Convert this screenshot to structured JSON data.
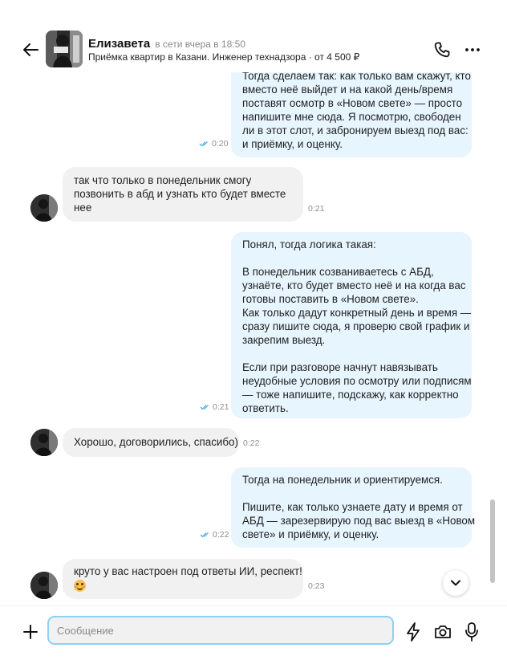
{
  "header": {
    "name": "Елизавета",
    "status": "в сети вчера в 18:50",
    "subtitle": "Приёмка квартир в Казани. Инженер технадзора · от 4 500 ₽"
  },
  "messages": [
    {
      "direction": "outgoing",
      "lines": [
        "Тогда сделаем так: как только вам скажут, кто",
        "вместо неё выйдет и на какой день/время",
        "поставят осмотр в «Новом свете» — просто",
        "напишите мне сюда. Я посмотрю, свободен",
        "ли в этот слот, и забронируем выезд под вас:",
        "и приёмку, и оценку."
      ],
      "time": "0:20"
    },
    {
      "direction": "incoming",
      "lines": [
        "так что только в понедельник смогу",
        "позвонить в абд и узнать кто будет вместе",
        "нее"
      ],
      "time": "0:21"
    },
    {
      "direction": "outgoing",
      "lines": [
        "Понял, тогда логика такая:",
        "",
        "В понедельник созваниваетесь с АБД,",
        "узнаёте, кто будет вместо неё и на когда вас",
        "готовы поставить в «Новом свете».",
        "Как только дадут конкретный день и время —",
        "сразу пишите сюда, я проверю свой график и",
        "закрепим выезд.",
        "",
        "Если при разговоре начнут навязывать",
        "неудобные условия по осмотру или подписям",
        "— тоже напишите, подскажу, как корректно",
        "ответить."
      ],
      "time": "0:21"
    },
    {
      "direction": "incoming",
      "lines": [
        "Хорошо, договорились, спасибо)"
      ],
      "time": "0:22"
    },
    {
      "direction": "outgoing",
      "lines": [
        "Тогда на понедельник и ориентируемся.",
        "",
        "Пишите, как только узнаете дату и время от",
        "АБД — зарезервирую под вас выезд в «Новом",
        "свете» и приёмку, и оценку."
      ],
      "time": "0:22"
    },
    {
      "direction": "incoming",
      "lines": [
        "круто у вас настроен под ответы ИИ, респект!"
      ],
      "has_emoji": true,
      "emoji": "smiling-face-icon",
      "time": "0:23"
    }
  ],
  "composer": {
    "placeholder": "Сообщение"
  },
  "colors": {
    "outgoing_bubble": "#e7f5fe",
    "incoming_bubble": "#f1f1f1",
    "read_check": "#4db2e8",
    "input_border": "#8fd0f3"
  }
}
